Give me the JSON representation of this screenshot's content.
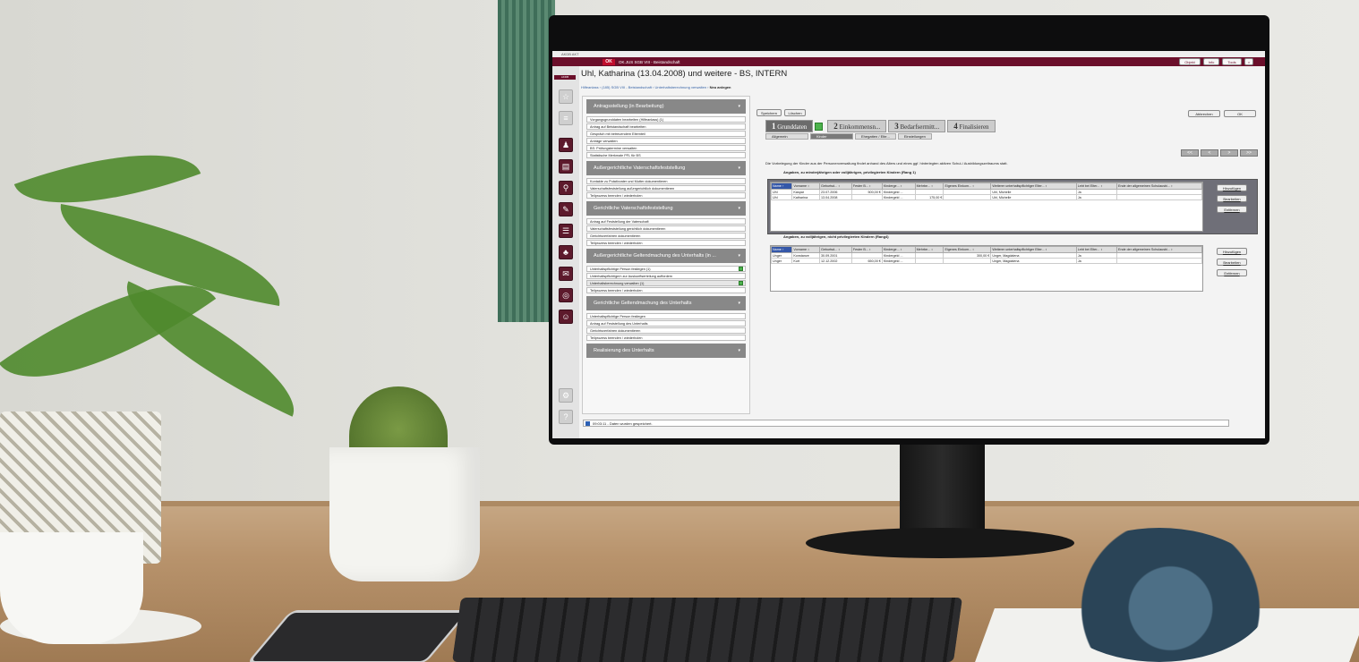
{
  "window": {
    "title": "AKDB AKT"
  },
  "app": {
    "badge": "OK",
    "name": "OK.JUS SGB VIII - Beistandschaft",
    "logo": "AKDB"
  },
  "top_buttons": {
    "objekt": "Objekt",
    "info": "Info",
    "tools": "Tools"
  },
  "header": {
    "title": "Uhl, Katharina (13.04.2008) und weitere - BS, INTERN"
  },
  "breadcrumb": {
    "path": "Hilfeanlass › (185) SGB VIII - Beistandschaft › Unterhaltsberechnung verwalten ›",
    "current": "Neu anlegen"
  },
  "sidebar": {
    "sections": [
      {
        "title": "Antragsstellung (in Bearbeitung)",
        "items": [
          {
            "label": "Vorgangsgrunddaten bearbeiten (Hilfeanlass) (1)"
          },
          {
            "label": "Antrag auf Beistandschaft bearbeiten"
          },
          {
            "label": "Gespräch mit betreuendem Elternteil"
          },
          {
            "label": "Anträge verwalten"
          },
          {
            "label": "BS: Prüfungstermine verwalten"
          },
          {
            "label": "Statistische Merkmale PFL für BS"
          }
        ]
      },
      {
        "title": "Außergerichtliche Vaterschaftsfeststellung",
        "items": [
          {
            "label": "Kontakte zu Putativvater und Mutter dokumentieren"
          },
          {
            "label": "Vaterschaftsfeststellung außergerichtlich dokumentieren"
          },
          {
            "label": "Teilprozess beenden / wiederholen"
          }
        ]
      },
      {
        "title": "Gerichtliche Vaterschaftsfeststellung",
        "items": [
          {
            "label": "Antrag auf Feststellung der Vaterschaft"
          },
          {
            "label": "Vaterschaftsfeststellung gerichtlich dokumentieren"
          },
          {
            "label": "Gerichtsverfahren dokumentieren"
          },
          {
            "label": "Teilprozess beenden / wiederholen"
          }
        ]
      },
      {
        "title": "Außergerichtliche Geltendmachung des Unterhalts (in ...",
        "items": [
          {
            "label": "Unterhaltspflichtige Person festlegen (1)",
            "check": true
          },
          {
            "label": "Unterhaltspflichtige/n zur Auskunftserteilung auffordern"
          },
          {
            "label": "Unterhaltsberechnung verwalten (1)",
            "check": true,
            "selected": true
          },
          {
            "label": "Teilprozess beenden / wiederholen"
          }
        ]
      },
      {
        "title": "Gerichtliche Geltendmachung des Unterhalts",
        "items": [
          {
            "label": "Unterhaltspflichtige Person festlegen"
          },
          {
            "label": "Antrag auf Feststellung des Unterhalts"
          },
          {
            "label": "Gerichtsverfahren dokumentieren"
          },
          {
            "label": "Teilprozess beenden / wiederholen"
          }
        ]
      },
      {
        "title": "Realisierung des Unterhalts",
        "items": []
      }
    ]
  },
  "toolbar": {
    "save": "Speichern",
    "delete": "Löschen",
    "cancel": "Abbrechen",
    "ok": "OK"
  },
  "tabs": [
    {
      "num": "1",
      "label": "Grunddaten",
      "check": true,
      "active": true
    },
    {
      "num": "2",
      "label": "Einkommensn..."
    },
    {
      "num": "3",
      "label": "Bedarfsermitt..."
    },
    {
      "num": "4",
      "label": "Finalisieren"
    }
  ],
  "subtabs": [
    {
      "label": "Allgemein",
      "check": true
    },
    {
      "label": "Kinder",
      "check": true,
      "active": true
    },
    {
      "label": "Ehegatten / Elte..."
    },
    {
      "label": "Einstellungen"
    }
  ],
  "nav": {
    "first": "<<",
    "prev": "<",
    "next": ">",
    "last": ">>"
  },
  "info_text": "Die Vorbelegung der Kinder aus der Personenverwaltung findet anhand des Alters und eines ggf. hinterlegten aktiven Schul-/ Ausbildungszeitraums statt.",
  "group1": {
    "label": "Angaben, zu minderjährigen oder volljährigen, privilegierten Kindern (Rang 1)",
    "columns": [
      "Name ↑",
      "Vorname ↕",
      "Geburtsd... ↕",
      "Fester B... ↕",
      "Kinderge... ↕",
      "Mehrbe... ↕",
      "Eigenes Einkom... ↕",
      "Weiterer unterhaltspflichtiger Elter... ↕",
      "Lebt bei Elter... ↕",
      "Ende der allgemeinen Schulausbi... ↕"
    ],
    "rows": [
      [
        "Uhl",
        "Kaspar",
        "23.07.2006",
        "500,00 €",
        "Kindergeld ...",
        "",
        "",
        "Uhl, Michelle",
        "Ja",
        ""
      ],
      [
        "Uhl",
        "Katharina",
        "13.04.2008",
        "",
        "Kindergeld ...",
        "175,00 €",
        "",
        "Uhl, Michelle",
        "Ja",
        ""
      ]
    ],
    "buttons": {
      "add": "Hinzufügen",
      "edit": "Bearbeiten",
      "remove": "Entfernen"
    }
  },
  "group2": {
    "label": "Angaben, zu volljährigen, nicht privilegierten Kindern (Rang4)",
    "columns": [
      "Name ↑",
      "Vorname ↕",
      "Geburtsd... ↕",
      "Fester B... ↕",
      "Kinderge... ↕",
      "Mehrbe... ↕",
      "Eigenes Einkom... ↕",
      "Weiterer unterhaltspflichtiger Elter... ↕",
      "Lebt bei Elter... ↕",
      "Ende der allgemeinen Schulausbi... ↕"
    ],
    "rows": [
      [
        "Unger",
        "Konstanze",
        "30.09.2001",
        "",
        "Kindergeld ...",
        "",
        "300,00 €",
        "Unger, Magdalena",
        "Ja",
        ""
      ],
      [
        "Unger",
        "Kurt",
        "12.12.2002",
        "650,00 €",
        "Kindergeld ...",
        "",
        "",
        "Unger, Magdalena",
        "Ja",
        ""
      ]
    ],
    "buttons": {
      "add": "Hinzufügen",
      "edit": "Bearbeiten",
      "remove": "Entfernen"
    }
  },
  "status": {
    "text": "09:03:11 - Daten wurden gespeichert."
  }
}
